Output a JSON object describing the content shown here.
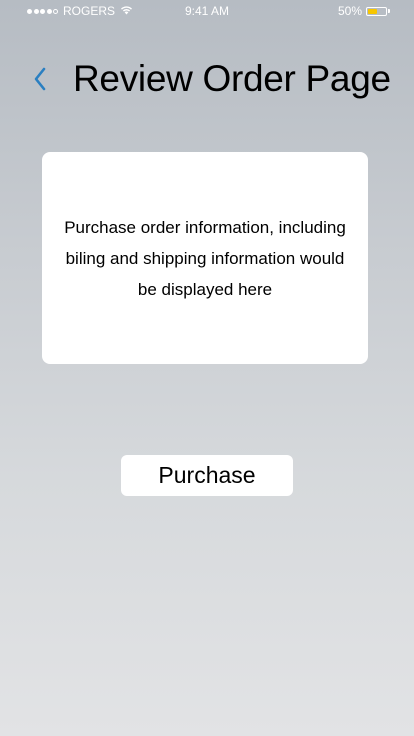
{
  "status_bar": {
    "carrier": "ROGERS",
    "time": "9:41 AM",
    "battery_percent": "50%",
    "battery_level": 0.5,
    "signal_bars_filled": 4,
    "signal_bars_total": 5,
    "battery_color": "#f7c600"
  },
  "header": {
    "back_icon": "chevron-left-icon",
    "back_color": "#2a7fc1",
    "title": "Review Order Page"
  },
  "order_info": {
    "text": "Purchase order information, including biling and shipping information would be displayed here"
  },
  "actions": {
    "purchase_label": "Purchase"
  }
}
